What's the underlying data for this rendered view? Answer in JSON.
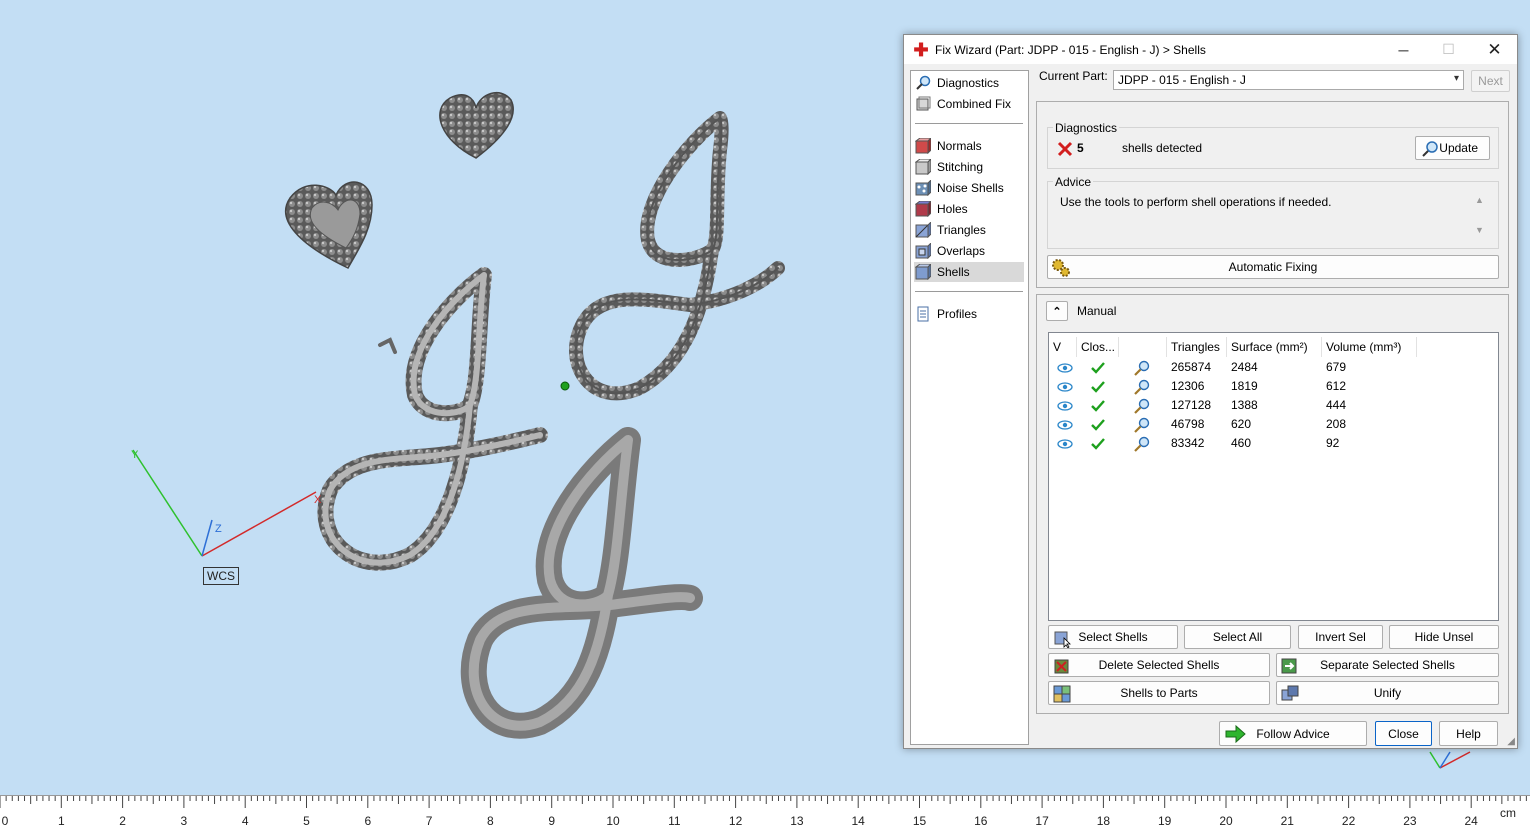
{
  "viewport": {
    "wcs_label": "WCS",
    "axis_labels": {
      "x": "X",
      "y": "Y",
      "z": "Z"
    }
  },
  "ruler": {
    "ticks": [
      "0",
      "1",
      "2",
      "3",
      "4",
      "5",
      "6",
      "7",
      "8",
      "9",
      "10",
      "11",
      "12",
      "13",
      "14",
      "15",
      "16",
      "17",
      "18",
      "19",
      "20",
      "21",
      "22",
      "23",
      "24"
    ],
    "unit": "cm"
  },
  "dialog": {
    "title": "Fix Wizard (Part: JDPP - 015 - English - J) > Shells",
    "nav": {
      "top": [
        "Diagnostics",
        "Combined Fix"
      ],
      "tools": [
        "Normals",
        "Stitching",
        "Noise Shells",
        "Holes",
        "Triangles",
        "Overlaps",
        "Shells"
      ],
      "bottom": [
        "Profiles"
      ],
      "active": "Shells"
    },
    "current_part_label": "Current Part:",
    "current_part_value": "JDPP - 015 - English - J",
    "next_label": "Next",
    "diagnostics": {
      "group_label": "Diagnostics",
      "count": "5",
      "status_text": "shells detected",
      "update_label": "Update"
    },
    "advice": {
      "group_label": "Advice",
      "text": "Use the tools to perform shell operations if needed."
    },
    "automatic_fixing_label": "Automatic Fixing",
    "manual_label": "Manual",
    "table": {
      "headers": [
        "V",
        "Clos...",
        "",
        "Triangles",
        "Surface (mm²)",
        "Volume (mm³)"
      ],
      "rows": [
        {
          "triangles": "265874",
          "surface": "2484",
          "volume": "679"
        },
        {
          "triangles": "12306",
          "surface": "1819",
          "volume": "612"
        },
        {
          "triangles": "127128",
          "surface": "1388",
          "volume": "444"
        },
        {
          "triangles": "46798",
          "surface": "620",
          "volume": "208"
        },
        {
          "triangles": "83342",
          "surface": "460",
          "volume": "92"
        }
      ]
    },
    "buttons": {
      "select_shells": "Select Shells",
      "select_all": "Select All",
      "invert_sel": "Invert Sel",
      "hide_unsel": "Hide Unsel",
      "delete_selected": "Delete Selected Shells",
      "separate_selected": "Separate Selected Shells",
      "shells_to_parts": "Shells to Parts",
      "unify": "Unify",
      "follow_advice": "Follow Advice",
      "close": "Close",
      "help": "Help"
    },
    "colors": {
      "check": "#1ea01e",
      "error": "#d21e1e",
      "eye": "#2a86c9"
    }
  }
}
